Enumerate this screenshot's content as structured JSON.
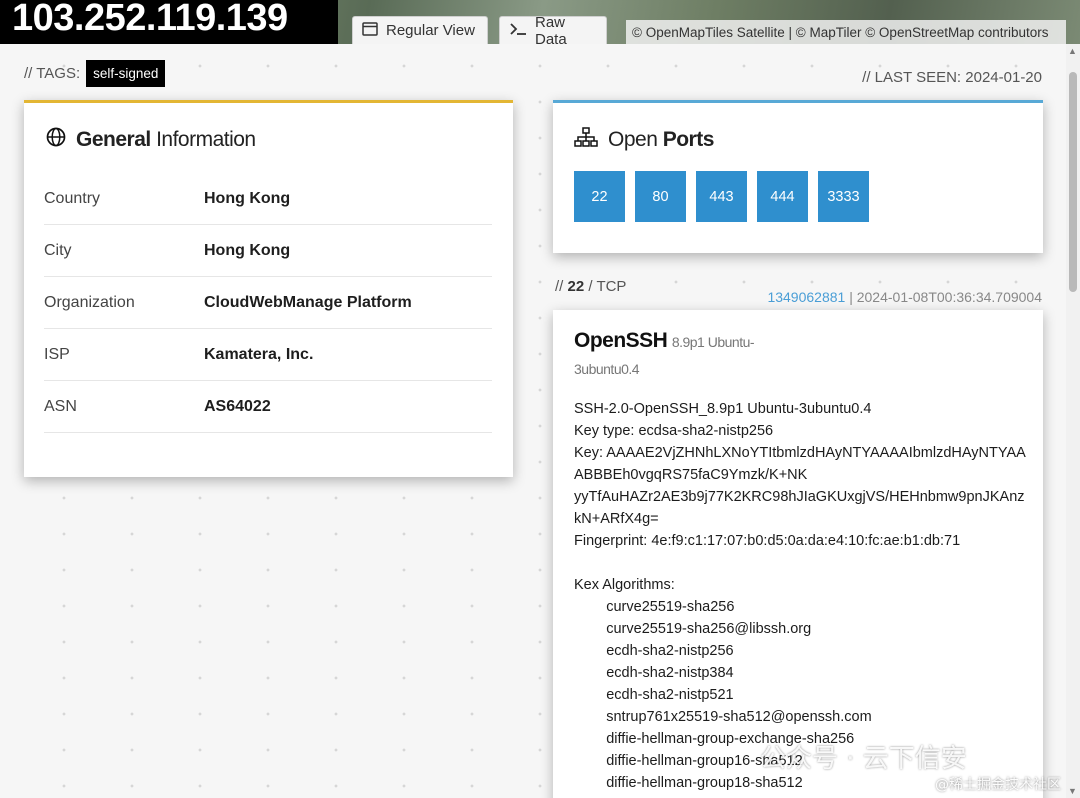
{
  "header": {
    "ip": "103.252.119.139",
    "regular_view": "Regular View",
    "raw_data": "Raw Data",
    "attribution": "© OpenMapTiles Satellite | © MapTiler © OpenStreetMap contributors"
  },
  "tags": {
    "prefix": "// TAGS:",
    "items": [
      "self-signed"
    ]
  },
  "last_seen": "// LAST SEEN: 2024-01-20",
  "general": {
    "title_bold": "General",
    "title_rest": "Information",
    "rows": [
      {
        "key": "Country",
        "value": "Hong Kong"
      },
      {
        "key": "City",
        "value": "Hong Kong"
      },
      {
        "key": "Organization",
        "value": "CloudWebManage Platform"
      },
      {
        "key": "ISP",
        "value": "Kamatera, Inc."
      },
      {
        "key": "ASN",
        "value": "AS64022"
      }
    ]
  },
  "ports": {
    "title_rest": "Open",
    "title_bold": "Ports",
    "items": [
      "22",
      "80",
      "443",
      "444",
      "3333"
    ]
  },
  "service": {
    "prefix": "//",
    "port": "22",
    "transport": "/ TCP",
    "hash": "1349062881",
    "timestamp": "| 2024-01-08T00:36:34.709004",
    "product": "OpenSSH",
    "version": "8.9p1 Ubuntu-3ubuntu0.4",
    "lines": [
      "SSH-2.0-OpenSSH_8.9p1 Ubuntu-3ubuntu0.4",
      "Key type: ecdsa-sha2-nistp256",
      "Key: AAAAE2VjZHNhLXNoYTItbmlzdHAyNTYAAAAIbmlzdHAyNTYAAABBBEh0vgqRS75faC9Ymzk/K+NK",
      "yyTfAuHAZr2AE3b9j77K2KRC98hJIaGKUxgjVS/HEHnbmw9pnJKAnzkN+ARfX4g=",
      "Fingerprint: 4e:f9:c1:17:07:b0:d5:0a:da:e4:10:fc:ae:b1:db:71",
      "",
      "Kex Algorithms:",
      "        curve25519-sha256",
      "        curve25519-sha256@libssh.org",
      "        ecdh-sha2-nistp256",
      "        ecdh-sha2-nistp384",
      "        ecdh-sha2-nistp521",
      "        sntrup761x25519-sha512@openssh.com",
      "        diffie-hellman-group-exchange-sha256",
      "        diffie-hellman-group16-sha512",
      "        diffie-hellman-group18-sha512"
    ]
  },
  "watermark": {
    "line1": "公众号 · 云下信安",
    "line2": "@稀土掘金技术社区"
  }
}
